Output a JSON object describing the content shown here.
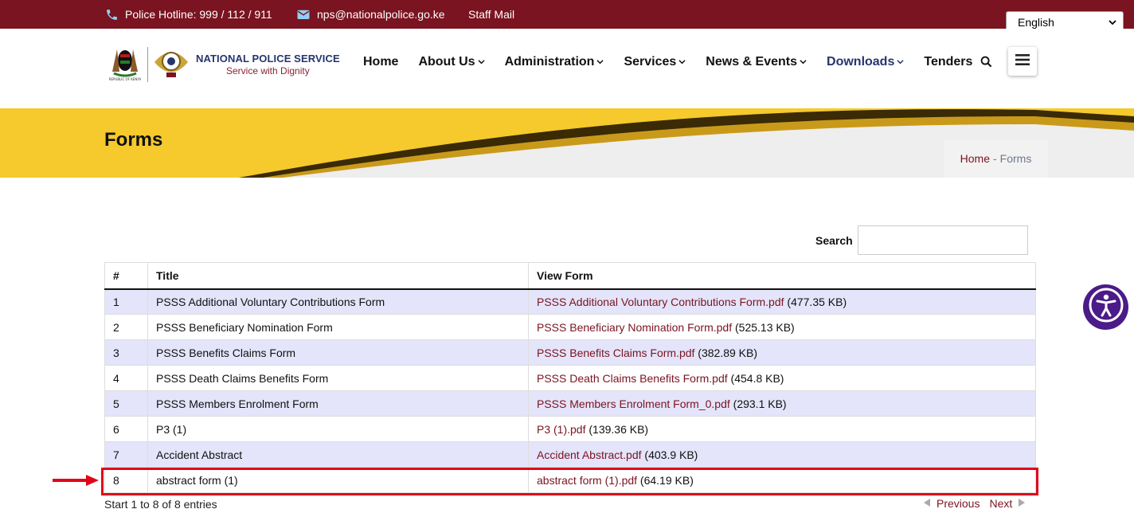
{
  "topbar": {
    "hotline": "Police Hotline: 999 / 112 / 911",
    "email": "nps@nationalpolice.go.ke",
    "staff_mail": "Staff Mail",
    "language": "English"
  },
  "logo": {
    "title": "NATIONAL POLICE SERVICE",
    "subtitle": "Service with Dignity",
    "coat_caption": "REPUBLIC OF KENYA"
  },
  "nav": {
    "home": "Home",
    "about": "About Us",
    "administration": "Administration",
    "services": "Services",
    "news": "News & Events",
    "downloads": "Downloads",
    "tenders": "Tenders"
  },
  "page": {
    "title": "Forms",
    "breadcrumb_home": "Home",
    "breadcrumb_sep": "-",
    "breadcrumb_current": "Forms"
  },
  "search": {
    "label": "Search",
    "value": ""
  },
  "table": {
    "headers": {
      "num": "#",
      "title": "Title",
      "view": "View Form"
    },
    "rows": [
      {
        "num": "1",
        "title": "PSSS Additional Voluntary Contributions Form",
        "file": "PSSS Additional Voluntary Contributions Form.pdf",
        "size": " (477.35 KB)"
      },
      {
        "num": "2",
        "title": "PSSS Beneficiary Nomination Form",
        "file": "PSSS Beneficiary Nomination Form.pdf",
        "size": " (525.13 KB)"
      },
      {
        "num": "3",
        "title": "PSSS Benefits Claims Form",
        "file": "PSSS Benefits Claims Form.pdf",
        "size": " (382.89 KB)"
      },
      {
        "num": "4",
        "title": "PSSS Death Claims Benefits Form",
        "file": "PSSS Death Claims Benefits Form.pdf",
        "size": " (454.8 KB)"
      },
      {
        "num": "5",
        "title": "PSSS Members Enrolment Form",
        "file": "PSSS Members Enrolment Form_0.pdf",
        "size": " (293.1 KB)"
      },
      {
        "num": "6",
        "title": "P3 (1)",
        "file": "P3 (1).pdf",
        "size": " (139.36 KB)"
      },
      {
        "num": "7",
        "title": "Accident Abstract",
        "file": "Accident Abstract.pdf",
        "size": " (403.9 KB)"
      },
      {
        "num": "8",
        "title": "abstract form (1)",
        "file": "abstract form (1).pdf",
        "size": " (64.19 KB)"
      }
    ]
  },
  "footer": {
    "info": "Start 1 to 8 of 8 entries",
    "previous": "Previous",
    "next": "Next"
  },
  "colors": {
    "maroon": "#7a1420",
    "navy": "#263470",
    "gold": "#f6c92c",
    "highlight_red": "#e0061a",
    "accessibility_purple": "#4b1b88"
  }
}
